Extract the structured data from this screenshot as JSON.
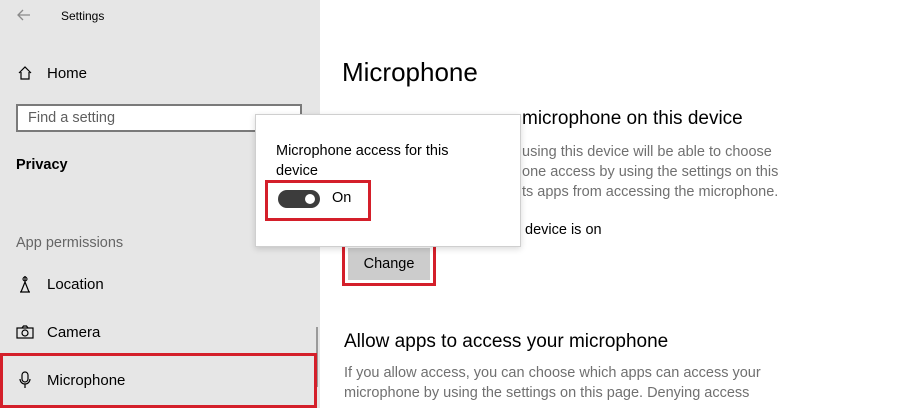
{
  "window": {
    "title": "Settings"
  },
  "sidebar": {
    "home_label": "Home",
    "search_placeholder": "Find a setting",
    "section_label": "Privacy",
    "group_label": "App permissions",
    "items": [
      {
        "label": "Location",
        "icon": "location-icon"
      },
      {
        "label": "Camera",
        "icon": "camera-icon"
      },
      {
        "label": "Microphone",
        "icon": "microphone-icon",
        "selected": true
      }
    ]
  },
  "main": {
    "title": "Microphone",
    "section1_heading_visible": "microphone on this device",
    "section1_text_visible": "using this device will be able to choose one access by using the settings on this ts apps from accessing the microphone.",
    "status_visible": "device is on",
    "change_button_label": "Change",
    "section2_heading": "Allow apps to access your microphone",
    "section2_text": "If you allow access, you can choose which apps can access your microphone by using the settings on this page. Denying access"
  },
  "popup": {
    "label": "Microphone access for this device",
    "toggle_state_label": "On",
    "toggle_on": true
  },
  "colors": {
    "highlight": "#d41f2a",
    "sidebar_bg": "#e6e6e6",
    "toggle_on": "#3c3c3c"
  }
}
